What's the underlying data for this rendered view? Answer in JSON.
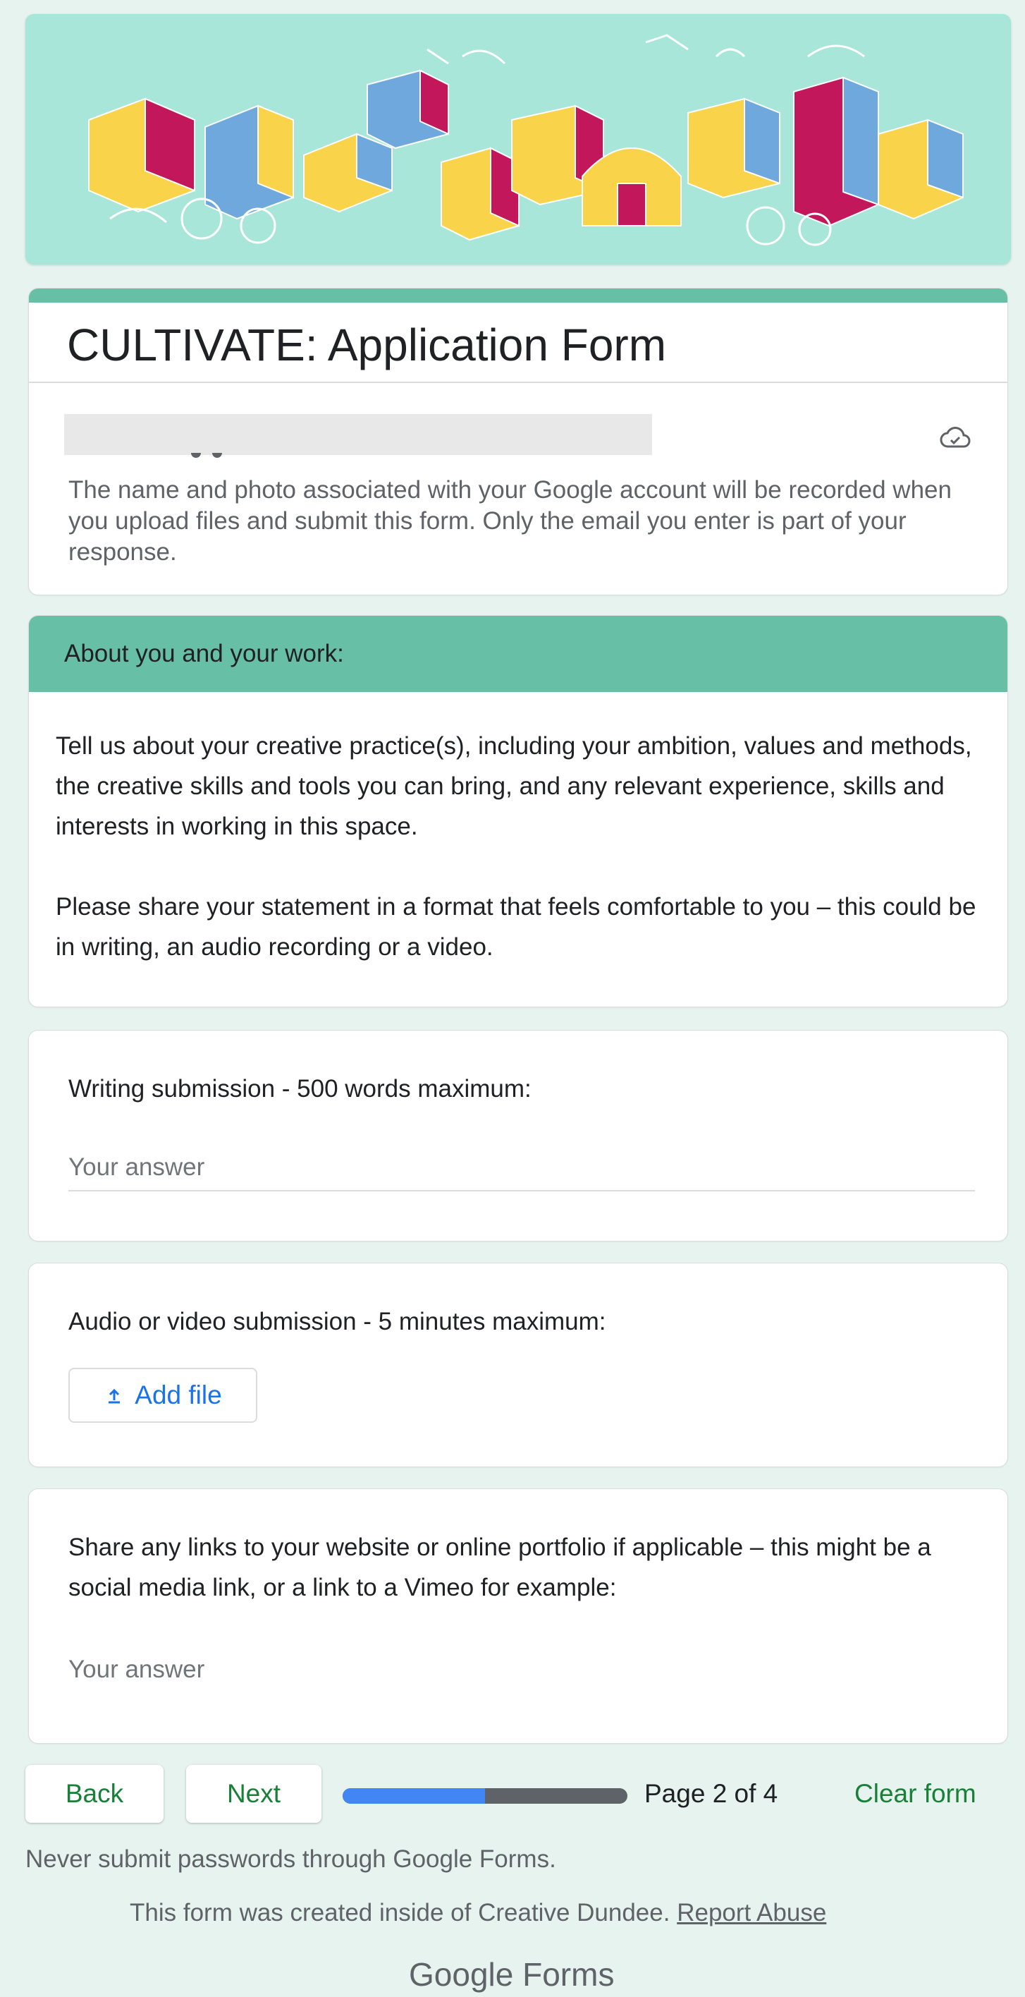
{
  "colors": {
    "accent": "#67bfa5",
    "button_text": "#188038",
    "link_blue": "#1a73e8",
    "progress_blue": "#4285f4"
  },
  "banner": {
    "icon": "cultivate-banner-illustration"
  },
  "form": {
    "title": "CULTIVATE: Application Form",
    "account_notice": "The name and photo associated with your Google account will be recorded when you upload files and submit this form. Only the email you enter is part of your response.",
    "cloud_icon": "cloud-saved-icon"
  },
  "section": {
    "header": "About you and your work:",
    "desc_1": "Tell us about your creative practice(s), including your ambition, values and methods, the creative skills and tools you can bring, and any relevant experience, skills and interests in working in this space.",
    "desc_2": "Please share your statement in a format that feels comfortable to you – this could be in writing, an audio recording or a video."
  },
  "questions": {
    "writing": {
      "label": "Writing submission - 500 words maximum:",
      "placeholder": "Your answer"
    },
    "media": {
      "label": "Audio or video submission - 5 minutes maximum:",
      "button": "Add file"
    },
    "links": {
      "label": "Share any links to your website or online portfolio if applicable – this might be a social media link, or a link to a Vimeo for example:",
      "placeholder": "Your answer"
    }
  },
  "nav": {
    "back": "Back",
    "next": "Next",
    "progress_fraction": 0.5,
    "page_label": "Page 2 of 4",
    "clear": "Clear form"
  },
  "footer": {
    "warning": "Never submit passwords through Google Forms.",
    "created": "This form was created inside of Creative Dundee.",
    "report": "Report Abuse",
    "brand_google": "Google",
    "brand_forms": "Forms"
  }
}
